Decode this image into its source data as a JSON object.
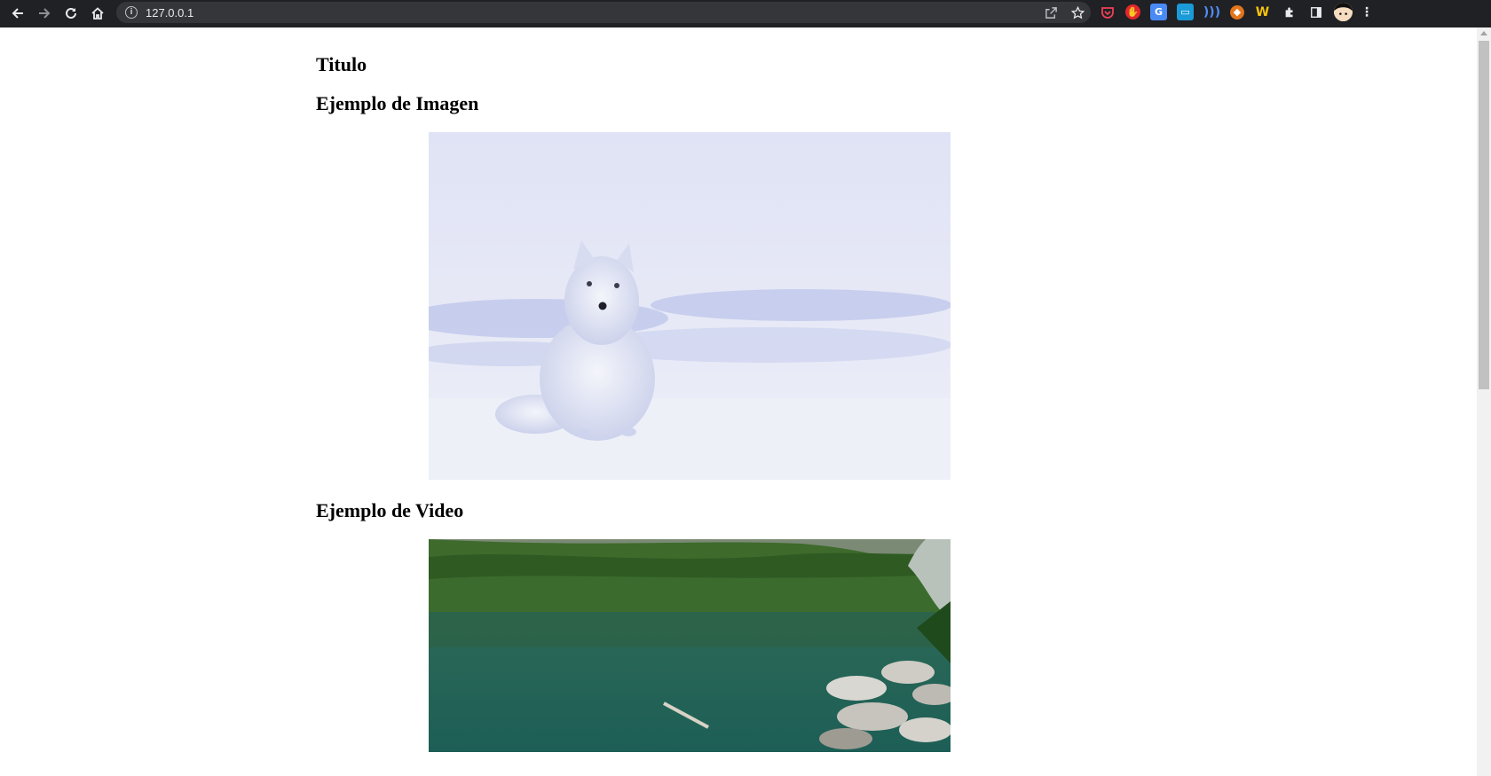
{
  "browser": {
    "url": "127.0.0.1",
    "nav_icons": [
      "back-arrow-icon",
      "forward-arrow-icon",
      "reload-icon",
      "home-icon"
    ],
    "omnibox_icons": [
      "share-icon",
      "star-icon"
    ],
    "extensions": [
      "pocket-icon",
      "adblock-icon",
      "translate-icon",
      "screenshot-icon",
      "wifi-icon",
      "metamask-icon",
      "w-extension-icon",
      "puzzle-icon",
      "sidebar-icon",
      "avatar",
      "menu-icon"
    ]
  },
  "page": {
    "title": "Titulo",
    "image_section_title": "Ejemplo de Imagen",
    "video_section_title": "Ejemplo de Video"
  },
  "colors": {
    "toolbar": "#202124",
    "omnibox": "#35363a",
    "page_bg": "#ffffff"
  }
}
